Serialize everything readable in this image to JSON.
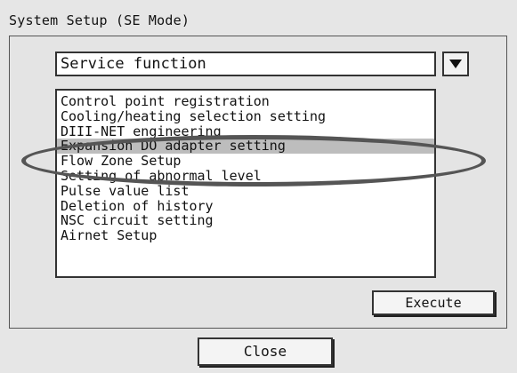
{
  "window": {
    "title": "System Setup (SE Mode)"
  },
  "function_select": {
    "value": "Service function",
    "dropdown_icon": "triangle-down-icon"
  },
  "function_list": {
    "items": [
      "Control point registration",
      "Cooling/heating selection setting",
      "DIII-NET engineering",
      "Expansion DO adapter setting",
      "Flow Zone Setup",
      "Setting of abnormal level",
      "Pulse value list",
      "Deletion of history",
      "NSC circuit setting",
      "Airnet Setup"
    ],
    "selected_index": 3
  },
  "buttons": {
    "execute": "Execute",
    "close": "Close"
  },
  "colors": {
    "background": "#e6e6e6",
    "selection": "#bdbdbd",
    "annotation_ellipse": "#555555"
  }
}
